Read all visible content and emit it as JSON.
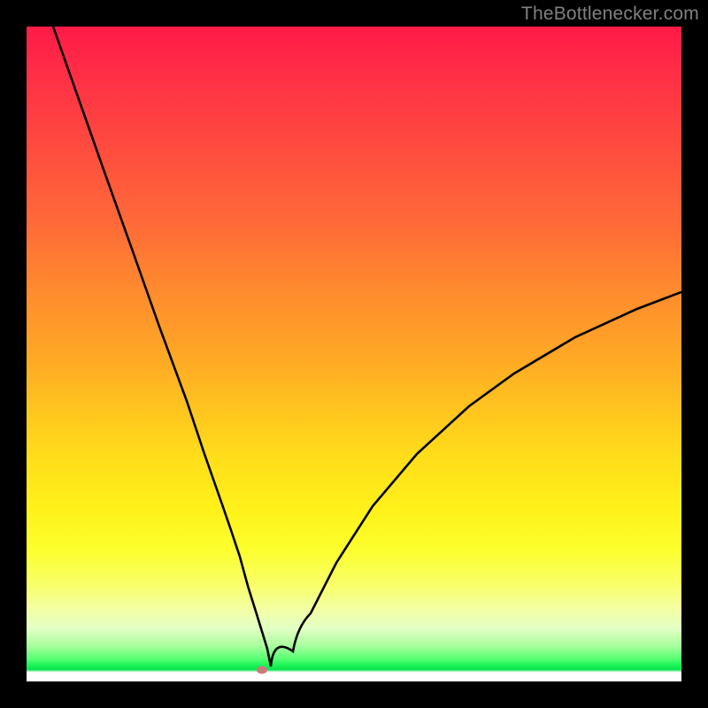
{
  "watermark": "TheBottlenecker.com",
  "chart_data": {
    "type": "line",
    "title": "",
    "xlabel": "",
    "ylabel": "",
    "xlim": [
      0,
      100
    ],
    "ylim": [
      0,
      100
    ],
    "series": [
      {
        "name": "bottleneck-curve",
        "x": [
          4.1,
          8.1,
          12.2,
          16.2,
          20.3,
          24.4,
          27.1,
          29.8,
          31.1,
          32.5,
          33.8,
          35.2,
          35.7,
          36.2,
          36.7,
          37.3,
          40.6,
          43.3,
          47.3,
          52.8,
          59.5,
          67.6,
          74.4,
          83.8,
          93.3,
          100.0
        ],
        "values": [
          100.0,
          88.5,
          77.1,
          65.7,
          54.2,
          42.8,
          34.8,
          27.1,
          23.1,
          19.0,
          14.6,
          10.3,
          8.5,
          6.8,
          5.0,
          2.3,
          4.6,
          10.4,
          18.1,
          26.8,
          34.8,
          42.1,
          47.1,
          52.6,
          56.9,
          59.5
        ]
      }
    ],
    "marker": {
      "x": 36.0,
      "y": 1.6,
      "color": "#cc7a7e"
    },
    "gradient_stops": [
      {
        "pos": 0.0,
        "color": "#ff1a47"
      },
      {
        "pos": 0.5,
        "color": "#ffa726"
      },
      {
        "pos": 0.8,
        "color": "#fcff2e"
      },
      {
        "pos": 0.97,
        "color": "#1cf658"
      },
      {
        "pos": 1.0,
        "color": "#ffffff"
      }
    ]
  }
}
